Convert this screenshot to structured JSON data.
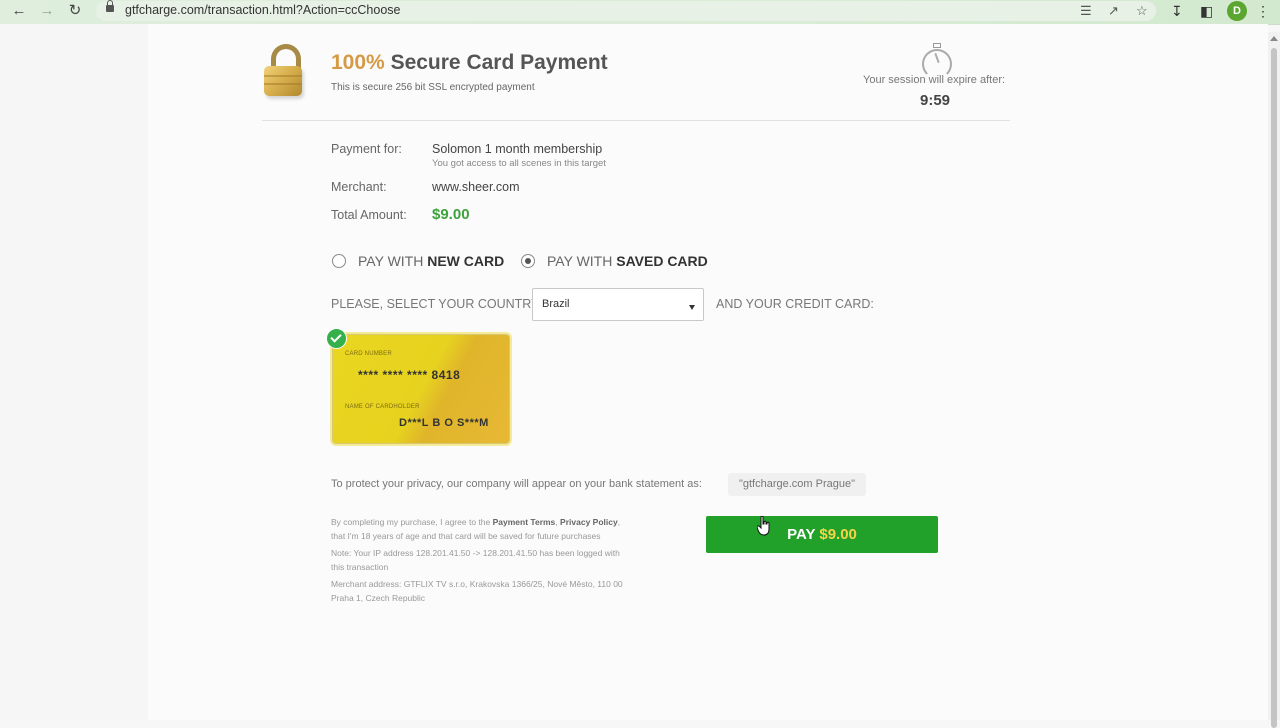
{
  "browser": {
    "url": "gtfcharge.com/transaction.html?Action=ccChoose",
    "profile_initial": "D"
  },
  "header": {
    "title_percent": "100%",
    "title_rest": "Secure Card Payment",
    "subtitle": "This is secure 256 bit SSL encrypted payment",
    "session_label": "Your session will expire after:",
    "session_time": "9:59"
  },
  "payment": {
    "payment_for_label": "Payment for:",
    "payment_for_value": "Solomon 1 month membership",
    "payment_for_note": "You got access to all scenes in this target",
    "merchant_label": "Merchant:",
    "merchant_value": "www.sheer.com",
    "total_label": "Total Amount:",
    "total_value": "$9.00"
  },
  "pay_options": {
    "new_card_prefix": "PAY WITH",
    "new_card_bold": "NEW CARD",
    "saved_card_prefix": "PAY WITH",
    "saved_card_bold": "SAVED CARD",
    "selected": "saved"
  },
  "country": {
    "label": "PLEASE, SELECT YOUR COUNTRY",
    "selected": "Brazil",
    "card_label": "AND YOUR CREDIT CARD:"
  },
  "saved_card": {
    "number_caption": "CARD NUMBER",
    "number": "**** **** **** 8418",
    "holder_caption": "NAME OF CARDHOLDER",
    "holder": "D***L B O S***M"
  },
  "privacy": {
    "text": "To protect your privacy, our company will appear on your bank statement as:",
    "descriptor": "\"gtfcharge.com Prague\""
  },
  "fine_print": {
    "line1_a": "By completing my purchase, I agree to the",
    "terms_link": "Payment Terms",
    "line1_sep": ",",
    "policy_link": "Privacy Policy",
    "line1_end": ",",
    "line2": "that I'm 18 years of age and that card will be saved for future purchases",
    "line3": "Note: Your IP address 128.201.41.50 -> 128.201.41.50 has been logged with",
    "line4": "this transaction",
    "line5": "Merchant address: GTFLIX TV s.r.o, Krakovska 1366/25, Nové Město, 110 00",
    "line6": "Praha 1, Czech Republic"
  },
  "pay_button": {
    "label": "PAY",
    "amount": "$9.00"
  },
  "icons": {
    "back": "arrow-left-icon",
    "forward": "arrow-right-icon",
    "reload": "reload-icon",
    "lock": "padlock-icon",
    "timer": "stopwatch-icon",
    "check": "check-icon"
  },
  "colors": {
    "title_accent": "#d59a45",
    "amount_green": "#3da33c",
    "pay_button": "#21a02a",
    "pay_amount": "#f4d548",
    "card_yellow": "#e9d621"
  }
}
